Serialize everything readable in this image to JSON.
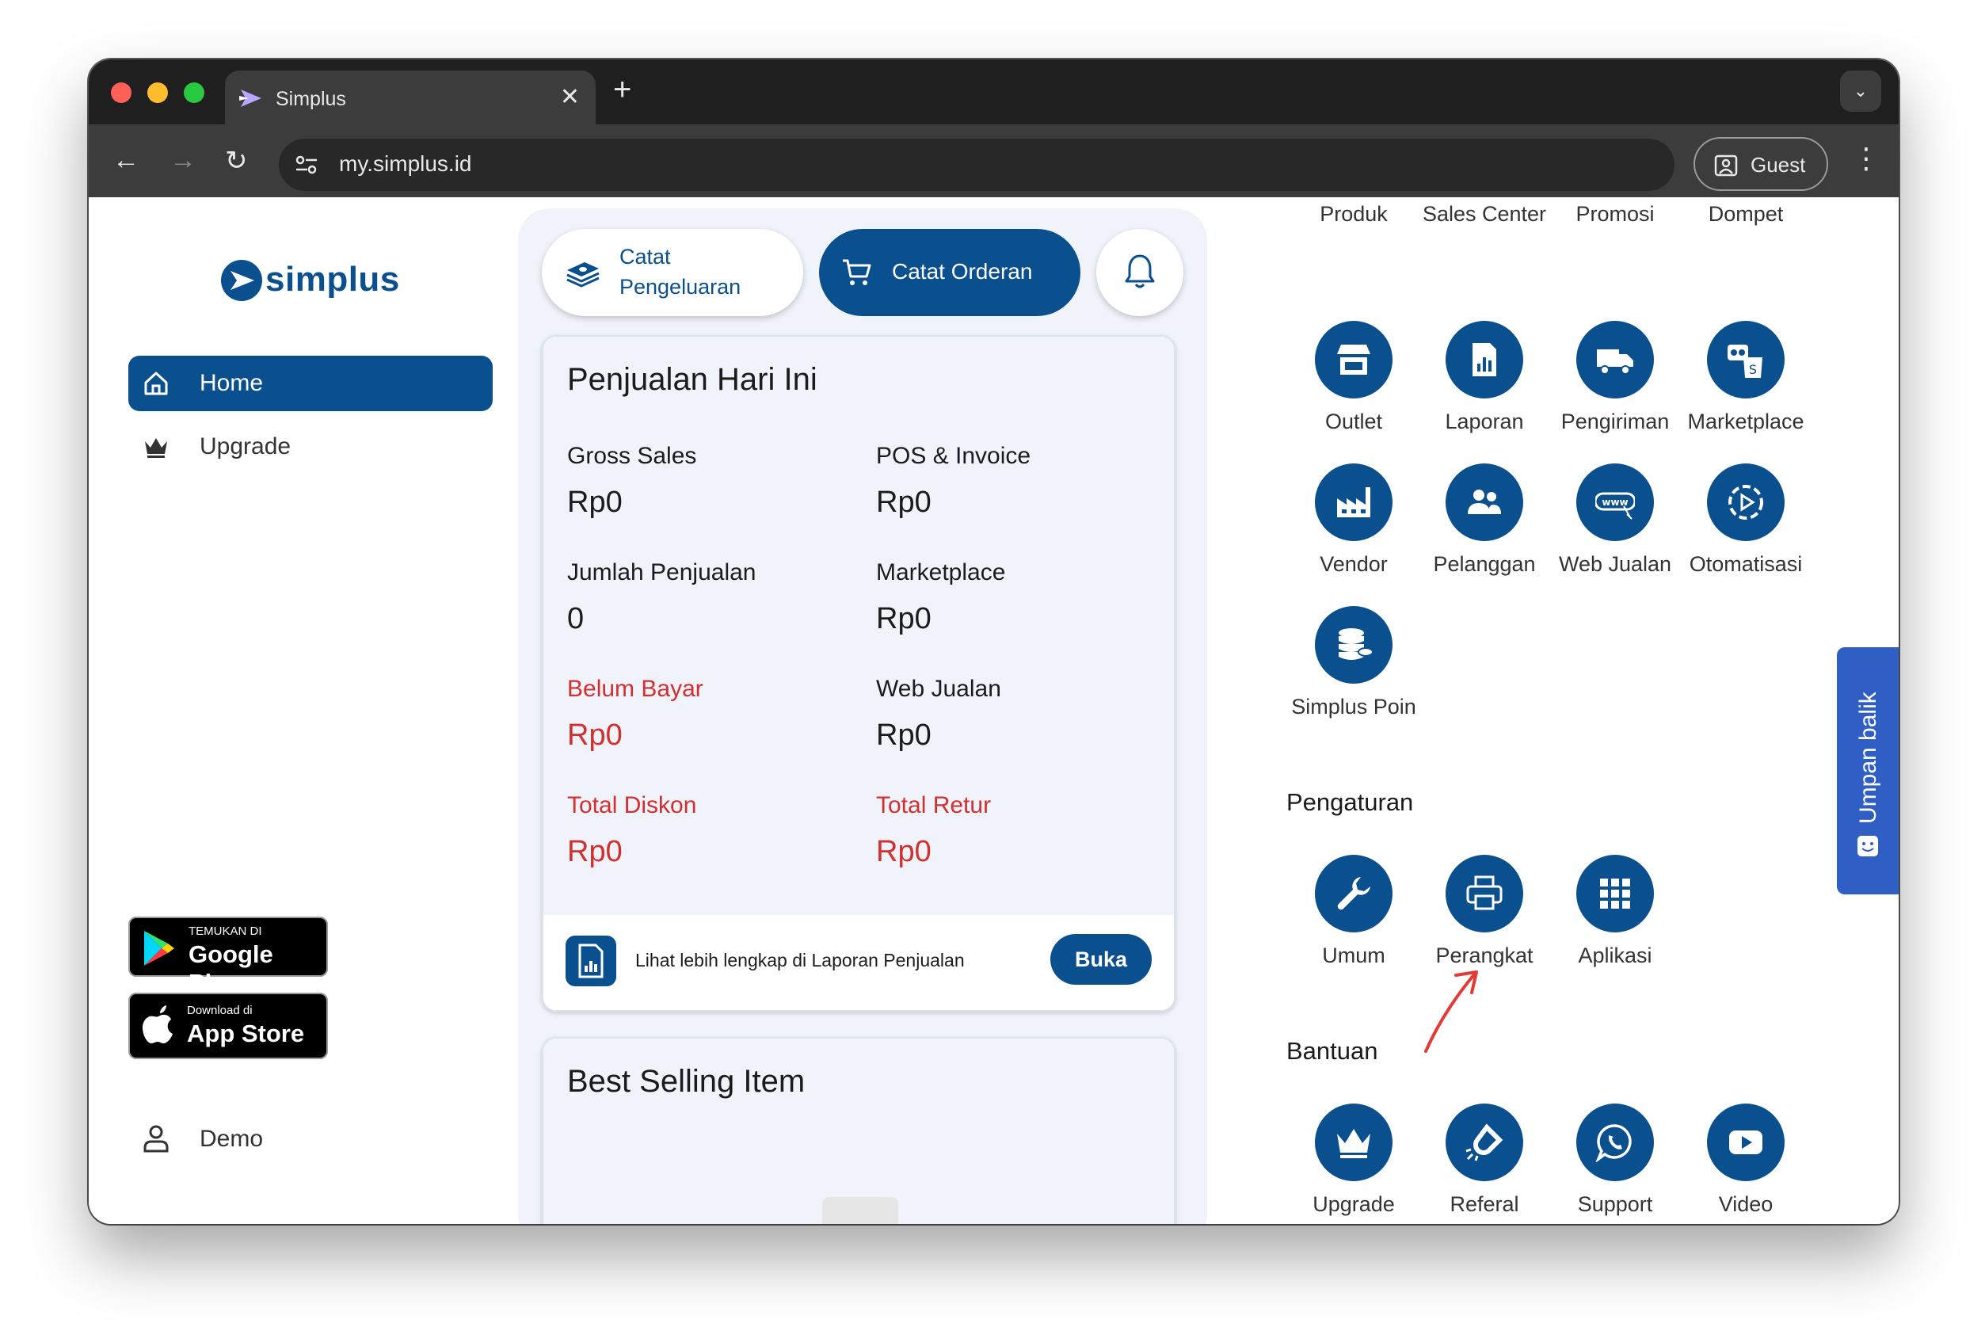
{
  "browser": {
    "tab_title": "Simplus",
    "tab_close": "✕",
    "new_tab": "+",
    "url": "my.simplus.id",
    "profile_label": "Guest"
  },
  "sidebar": {
    "logo_text": "simplus",
    "items": [
      {
        "label": "Home",
        "active": true,
        "icon": "home-icon"
      },
      {
        "label": "Upgrade",
        "active": false,
        "icon": "crown-icon"
      }
    ],
    "google_play": {
      "small": "TEMUKAN DI",
      "big": "Google Play"
    },
    "app_store": {
      "small": "Download di",
      "big": "App Store"
    },
    "user": {
      "label": "Demo",
      "icon": "user-icon"
    }
  },
  "actions": {
    "expense_line1": "Catat",
    "expense_line2": "Pengeluaran",
    "order_label": "Catat Orderan"
  },
  "sales_today": {
    "title": "Penjualan Hari Ini",
    "metrics": [
      {
        "label": "Gross Sales",
        "value": "Rp0",
        "highlight": false
      },
      {
        "label": "POS & Invoice",
        "value": "Rp0",
        "highlight": false
      },
      {
        "label": "Jumlah Penjualan",
        "value": "0",
        "highlight": false
      },
      {
        "label": "Marketplace",
        "value": "Rp0",
        "highlight": false
      },
      {
        "label": "Belum Bayar",
        "value": "Rp0",
        "highlight": true
      },
      {
        "label": "Web Jualan",
        "value": "Rp0",
        "highlight": false
      },
      {
        "label": "Total Diskon",
        "value": "Rp0",
        "highlight": true
      },
      {
        "label": "Total Retur",
        "value": "Rp0",
        "highlight": true
      }
    ],
    "footer_text": "Lihat lebih lengkap di Laporan Penjualan",
    "open_button": "Buka"
  },
  "best_selling": {
    "title": "Best Selling Item"
  },
  "menu": {
    "top_row": [
      "Produk",
      "Sales Center",
      "Promosi",
      "Dompet"
    ],
    "items": [
      {
        "label": "Outlet",
        "icon": "store-icon"
      },
      {
        "label": "Laporan",
        "icon": "report-icon"
      },
      {
        "label": "Pengiriman",
        "icon": "truck-icon"
      },
      {
        "label": "Marketplace",
        "icon": "shopping-bag-icon"
      },
      {
        "label": "Vendor",
        "icon": "factory-icon"
      },
      {
        "label": "Pelanggan",
        "icon": "users-icon"
      },
      {
        "label": "Web Jualan",
        "icon": "www-icon"
      },
      {
        "label": "Otomatisasi",
        "icon": "automation-icon"
      },
      {
        "label": "Simplus Poin",
        "icon": "coins-icon"
      }
    ]
  },
  "settings": {
    "title": "Pengaturan",
    "items": [
      {
        "label": "Umum",
        "icon": "wrench-icon"
      },
      {
        "label": "Perangkat",
        "icon": "printer-icon"
      },
      {
        "label": "Aplikasi",
        "icon": "grid-icon"
      }
    ]
  },
  "help": {
    "title": "Bantuan",
    "items": [
      {
        "label": "Upgrade",
        "icon": "crown-icon"
      },
      {
        "label": "Referal",
        "icon": "magnet-icon"
      },
      {
        "label": "Support",
        "icon": "whatsapp-icon"
      },
      {
        "label": "Video",
        "icon": "youtube-icon"
      }
    ]
  },
  "feedback": {
    "label": "Umpan balik"
  },
  "colors": {
    "primary": "#0a4f8e",
    "danger": "#d32f2f",
    "feedback": "#2f5fc5"
  }
}
